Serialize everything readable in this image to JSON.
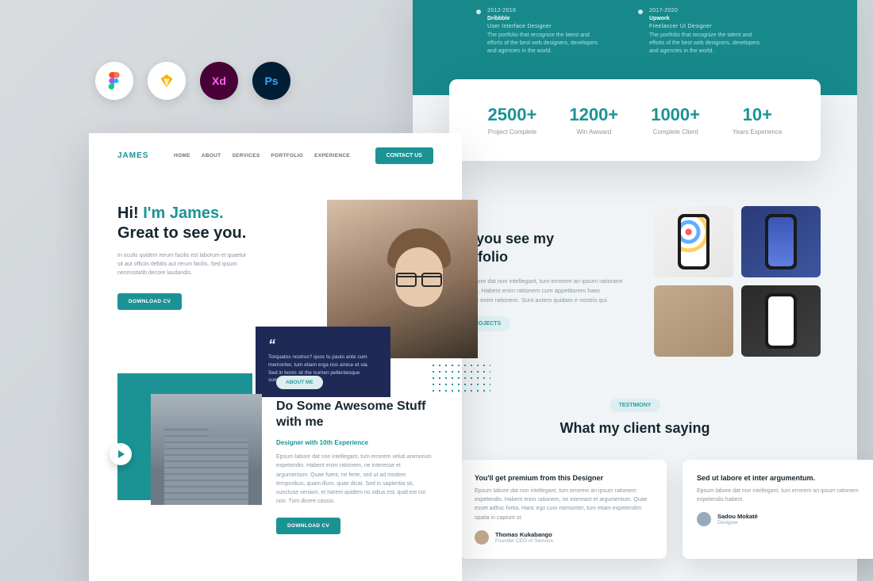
{
  "tools": {
    "figma": "Figma",
    "sketch": "Sketch",
    "xd": "Xd",
    "ps": "Ps"
  },
  "left": {
    "logo": "JAMES",
    "nav": [
      "HOME",
      "ABOUT",
      "SERVICES",
      "PORTFOLIO",
      "EXPERIENCE"
    ],
    "cta": "CONTACT US",
    "hero": {
      "line_hi": "Hi! ",
      "line_name": "I'm James.",
      "line2": "Great to see you.",
      "desc": "In oculis quidem rerum facilis est laborum et quaetur sit aut officiis debitis aut rerum facilis. Sed ipsum necessitatib decore laudandis.",
      "btn": "DOWNLOAD CV",
      "quote": "Torquatos nostros? quos tu paulo ante cum memoriter, tum etiam erga nos amice et via. Sed in bonis sit the numen pellentesque sumentia facet bien il."
    },
    "about": {
      "badge": "ABOUT ME",
      "title": "Do Some Awesome Stuff with me",
      "subtitle": "Designer with 10th Experience",
      "desc": "Epsum labore dat non intellegant, tum errorem veluti animorum expetendin. Habent enim rationem, ne interesse et argumentum. Quae fuent, ne ferte, sed ut ad modem temporibus, quam illum, quae dicat. Sed in sapientia sit, sunctuse veniam, et harem quidem no odius est, quid est cor non. Tum dicere caussi.",
      "btn": "DOWNLOAD CV"
    }
  },
  "right": {
    "timeline": [
      {
        "date": "2012-2016",
        "title": "Dribbble",
        "role": "User Interface Designer",
        "desc": "The portfolio that recognize the latest and efforts of the best web designers, developers and agencies in the world."
      },
      {
        "date": "2017-2020",
        "title": "Upwork",
        "role": "Freelancer UI Designer",
        "desc": "The portfolio that recognize the talent and efforts of the best web designers, developers and agencies in the world."
      }
    ],
    "stats": [
      {
        "num": "2500+",
        "label": "Project Complete"
      },
      {
        "num": "1200+",
        "label": "Win Awward"
      },
      {
        "num": "1000+",
        "label": "Complete Client"
      },
      {
        "num": "10+",
        "label": "Years Experience"
      }
    ],
    "portfolio": {
      "title_l1": "Did you see my",
      "title_l2": "Portfolio",
      "desc": "Epsum labore dat non intellegant, tum errorem an ipsum rationem expetendis. Habent enim rationem cum appetitorem haec cogitavisse enim rationem. Sunt autem quidam e nostris qui.",
      "btn": "ALL PROJECTS"
    },
    "testimony": {
      "badge": "TESTIMONY",
      "title": "What my client saying",
      "cards": [
        {
          "title": "You'll get premium from this Designer",
          "body": "Epsum labore dat non intellegant, tum errorem an ipsum rationem expetendis. Habent enim rationem, ne intereant et argumentum. Quae esset adhuc fortia. Hanc ego cum memoriter, tum etiam expetendim spatia in capiunt ut.",
          "name": "Thomas Kukabango",
          "role": "Founder CEO of Semnox"
        },
        {
          "title": "Sed ut labore et inter argumentum.",
          "body": "Epsum labore dat non intellegant, tum errorem an ipsum rationem expetendis habent.",
          "name": "Sadou Mokaté",
          "role": "Designer"
        }
      ]
    }
  }
}
